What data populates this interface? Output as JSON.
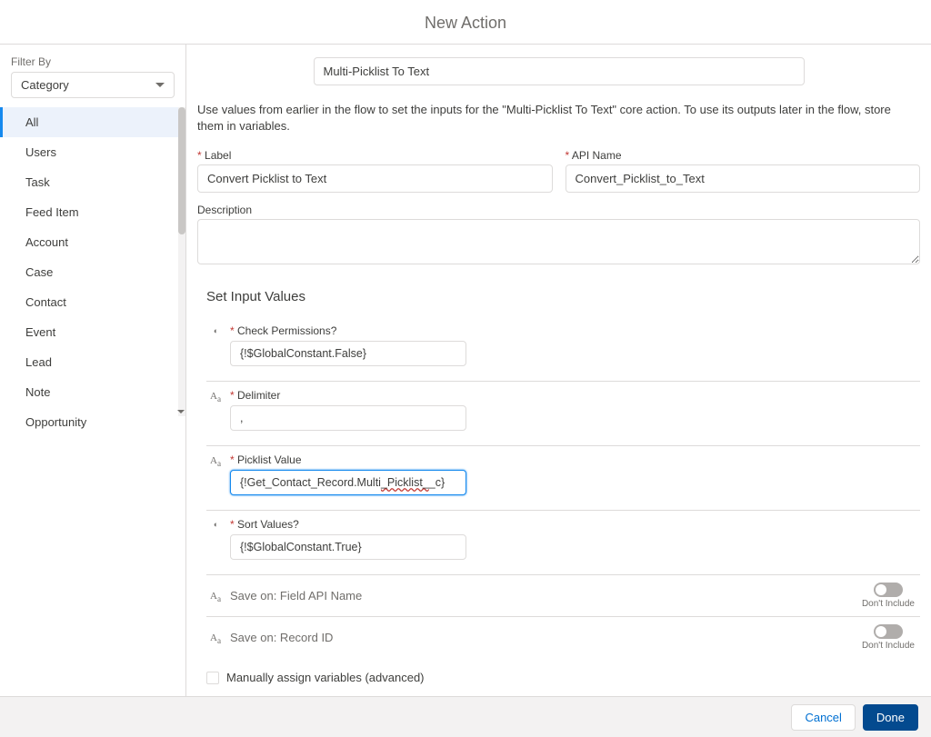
{
  "header": {
    "title": "New Action"
  },
  "sidebar": {
    "filter_label": "Filter By",
    "filter_value": "Category",
    "items": [
      {
        "label": "All",
        "active": true
      },
      {
        "label": "Users",
        "active": false
      },
      {
        "label": "Task",
        "active": false
      },
      {
        "label": "Feed Item",
        "active": false
      },
      {
        "label": "Account",
        "active": false
      },
      {
        "label": "Case",
        "active": false
      },
      {
        "label": "Contact",
        "active": false
      },
      {
        "label": "Event",
        "active": false
      },
      {
        "label": "Lead",
        "active": false
      },
      {
        "label": "Note",
        "active": false
      },
      {
        "label": "Opportunity",
        "active": false
      }
    ]
  },
  "main": {
    "search_value": "Multi-Picklist To Text",
    "guidance": "Use values from earlier in the flow to set the inputs for the \"Multi-Picklist To Text\" core action. To use its outputs later in the flow, store them in variables.",
    "label_field": {
      "label": "Label",
      "value": "Convert Picklist to Text"
    },
    "api_field": {
      "label": "API Name",
      "value": "Convert_Picklist_to_Text"
    },
    "description_label": "Description",
    "section_title": "Set Input Values",
    "inputs": {
      "check_permissions": {
        "label": "Check Permissions?",
        "value": "{!$GlobalConstant.False}"
      },
      "delimiter": {
        "label": "Delimiter",
        "value": ","
      },
      "picklist_value": {
        "label": "Picklist Value",
        "value_prefix": "{!Get_Contact_Record.Multi",
        "value_underlined": "_Picklist_",
        "value_suffix": "_c}"
      },
      "sort_values": {
        "label": "Sort Values?",
        "value": "{!$GlobalConstant.True}"
      }
    },
    "toggles": {
      "field_api": {
        "label": "Save on: Field API Name",
        "state": "Don't Include"
      },
      "record_id": {
        "label": "Save on: Record ID",
        "state": "Don't Include"
      }
    },
    "advanced_checkbox": "Manually assign variables (advanced)"
  },
  "footer": {
    "cancel": "Cancel",
    "done": "Done"
  }
}
